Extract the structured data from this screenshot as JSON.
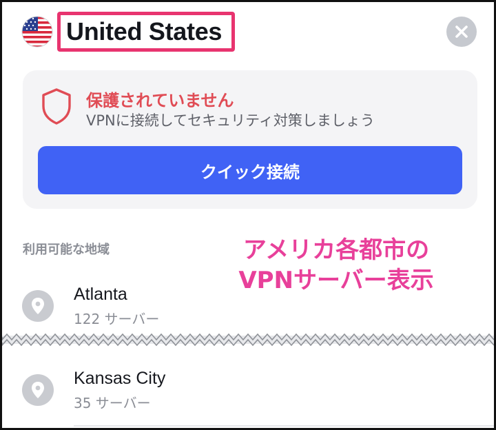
{
  "header": {
    "country": "United States",
    "flag_icon": "us-flag-icon",
    "close_icon": "close-icon"
  },
  "status": {
    "title": "保護されていません",
    "description": "VPNに接続してセキュリティ対策しましょう",
    "button_label": "クイック接続",
    "shield_icon": "shield-icon"
  },
  "regions": {
    "section_label": "利用可能な地域",
    "items": [
      {
        "city": "Atlanta",
        "servers": "122 サーバー",
        "icon": "location-pin-icon"
      },
      {
        "city": "Kansas City",
        "servers": "35 サーバー",
        "icon": "location-pin-icon"
      }
    ]
  },
  "annotation": {
    "line1": "アメリカ各都市の",
    "line2": "VPNサーバー表示"
  },
  "colors": {
    "accent_blue": "#4062f5",
    "warning_red": "#e04c55",
    "highlight_pink": "#e8346f",
    "annotation_pink": "#e8409a"
  }
}
